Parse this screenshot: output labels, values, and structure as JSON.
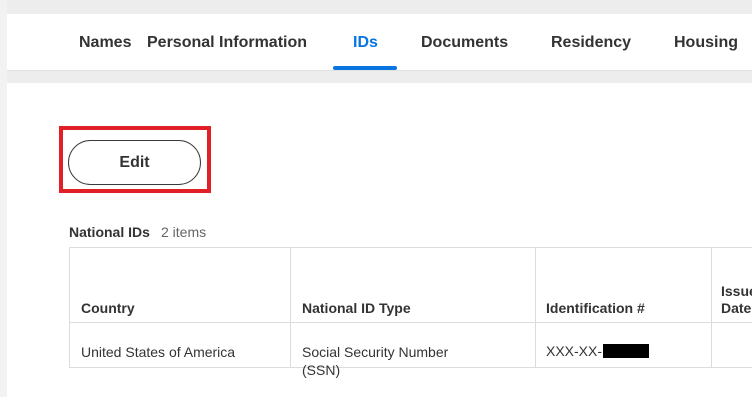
{
  "tabs": [
    {
      "label": "Names",
      "active": false
    },
    {
      "label": "Personal Information",
      "active": false
    },
    {
      "label": "IDs",
      "active": true
    },
    {
      "label": "Documents",
      "active": false
    },
    {
      "label": "Residency",
      "active": false
    },
    {
      "label": "Housing",
      "active": false
    }
  ],
  "actions": {
    "edit_label": "Edit"
  },
  "colors": {
    "accent": "#0875e1",
    "highlight": "#e01f26",
    "redaction": "#000000"
  },
  "national_ids": {
    "title": "National IDs",
    "count": "2 items",
    "columns": [
      "Country",
      "National ID Type",
      "Identification #",
      "Issue Date"
    ],
    "column_header_partial": [
      "Issue",
      "Date"
    ],
    "rows": [
      {
        "country": "United States of America",
        "type_line1": "Social Security Number",
        "type_line2": "(SSN)",
        "identification": "XXX-XX-",
        "identification_redacted": true
      }
    ]
  }
}
